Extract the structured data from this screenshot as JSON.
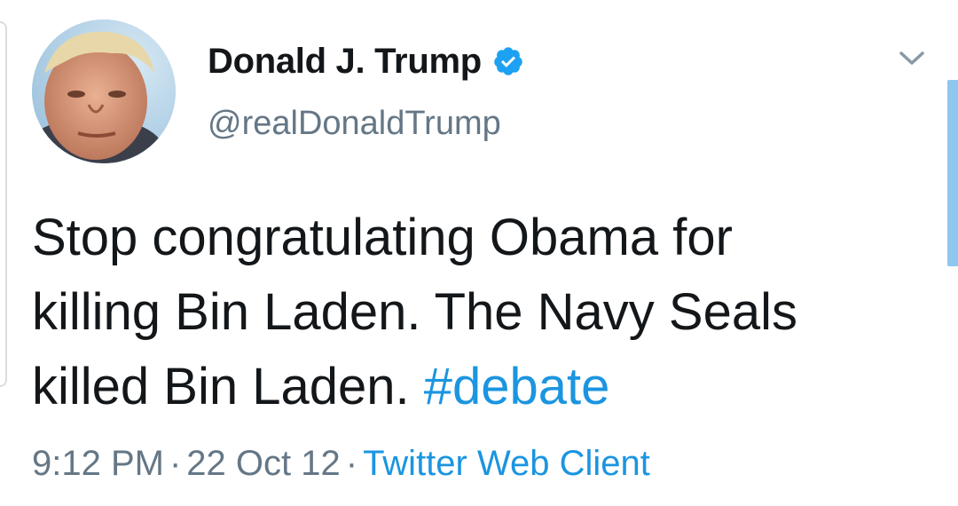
{
  "tweet": {
    "author": {
      "display_name": "Donald J. Trump",
      "handle": "@realDonaldTrump",
      "verified": true,
      "avatar_icon": "profile-photo"
    },
    "text_line1": "Stop congratulating Obama for",
    "text_line2": "killing Bin Laden. The Navy Seals",
    "text_line3_plain": "killed Bin Laden.",
    "hashtag": "#debate",
    "time": "9:12 PM",
    "date": "22 Oct 12",
    "separator": "·",
    "source": "Twitter Web Client"
  },
  "icons": {
    "verified": "verified-badge-icon",
    "menu": "chevron-down-icon"
  },
  "colors": {
    "link": "#1b95e0",
    "text": "#14171a",
    "secondary": "#657786",
    "scrollbar": "#8fc7f0"
  }
}
